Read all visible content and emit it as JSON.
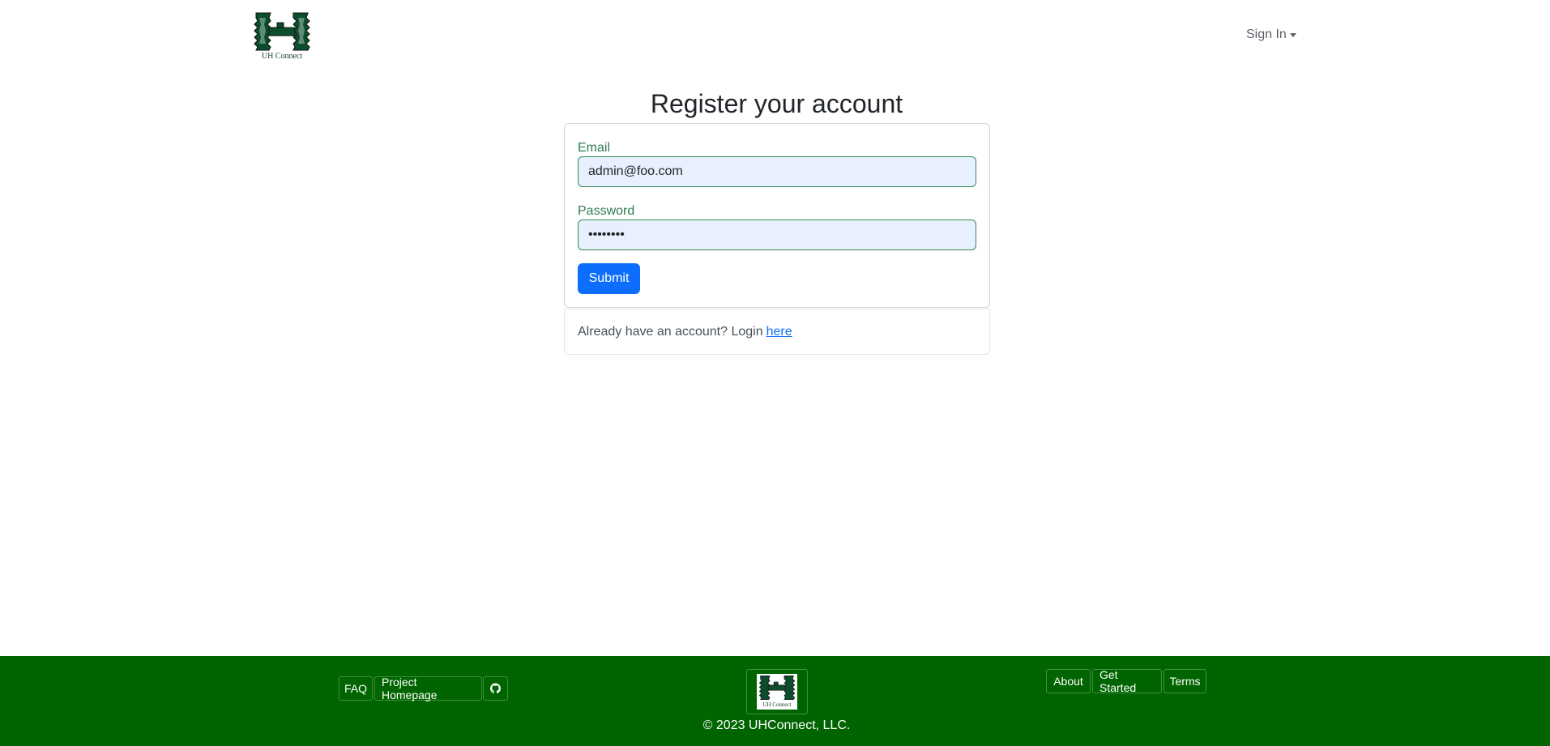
{
  "header": {
    "brand_text": "UH Connect",
    "signin_label": "Sign In"
  },
  "main": {
    "title": "Register your account",
    "email": {
      "label": "Email",
      "value": "admin@foo.com"
    },
    "password": {
      "label": "Password",
      "value": "changeme"
    },
    "submit_label": "Submit",
    "login_prompt": "Already have an account? Login",
    "login_link": "here"
  },
  "footer": {
    "left_links": [
      "FAQ",
      "Project Homepage"
    ],
    "github_icon": "github-icon",
    "logo_text": "UH Connect",
    "right_links": [
      "About",
      "Get Started",
      "Terms"
    ],
    "copyright": "© 2023 UHConnect, LLC."
  },
  "colors": {
    "brand_green": "#006400",
    "primary_blue": "#0d6efd",
    "label_green": "#2e7d4f",
    "input_fill": "#e8f0fe"
  }
}
